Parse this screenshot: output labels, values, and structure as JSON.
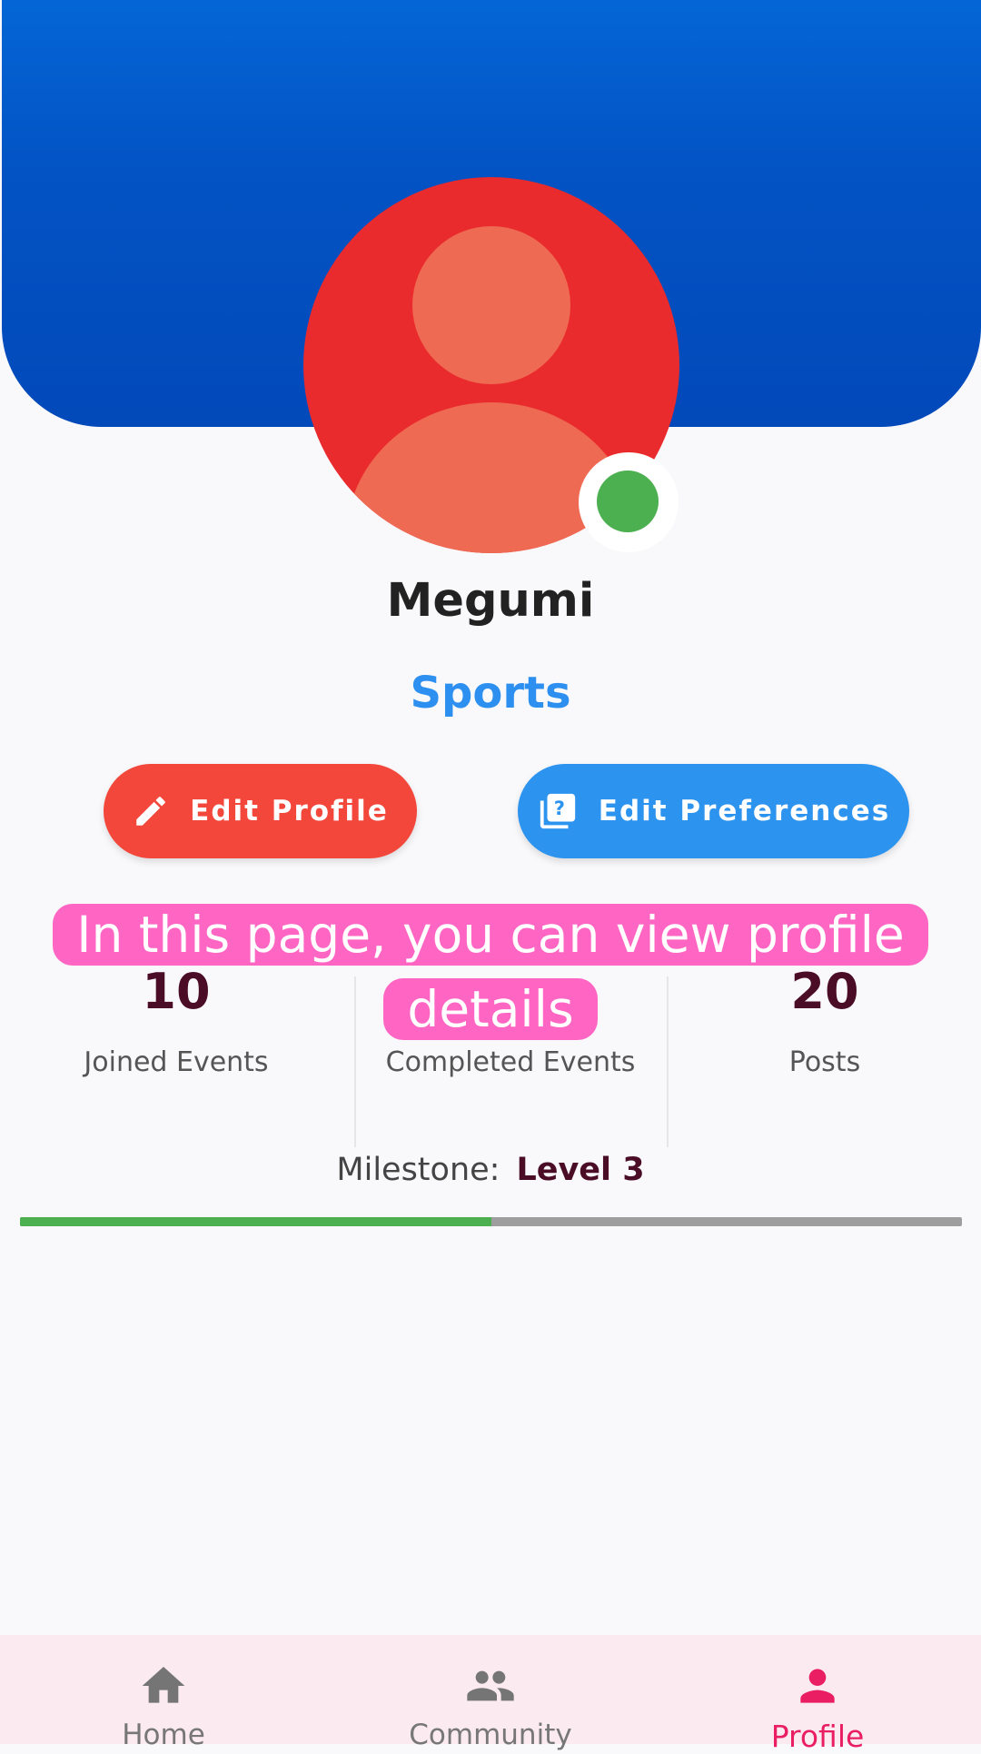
{
  "profile": {
    "name": "Megumi",
    "interest": "Sports",
    "online_color": "#4caf50"
  },
  "actions": {
    "edit_profile": "Edit Profile",
    "edit_preferences": "Edit Preferences"
  },
  "stats": [
    {
      "value": "10",
      "label": "Joined Events"
    },
    {
      "value": "",
      "label": "Completed Events"
    },
    {
      "value": "20",
      "label": "Posts"
    }
  ],
  "milestone": {
    "label": "Milestone:",
    "level": "Level 3",
    "progress_fraction": 0.5
  },
  "tooltip": {
    "text": "In this page, you can view profile details"
  },
  "nav": {
    "items": [
      {
        "label": "Home",
        "icon": "home-icon",
        "active": false
      },
      {
        "label": "Community",
        "icon": "people-icon",
        "active": false
      },
      {
        "label": "Profile",
        "icon": "person-icon",
        "active": true
      }
    ]
  },
  "colors": {
    "header": "#0353c4",
    "edit_button": "#f2473a",
    "preferences_button": "#2c93ef",
    "active_nav": "#e91e63",
    "tooltip": "#ff66c4"
  }
}
